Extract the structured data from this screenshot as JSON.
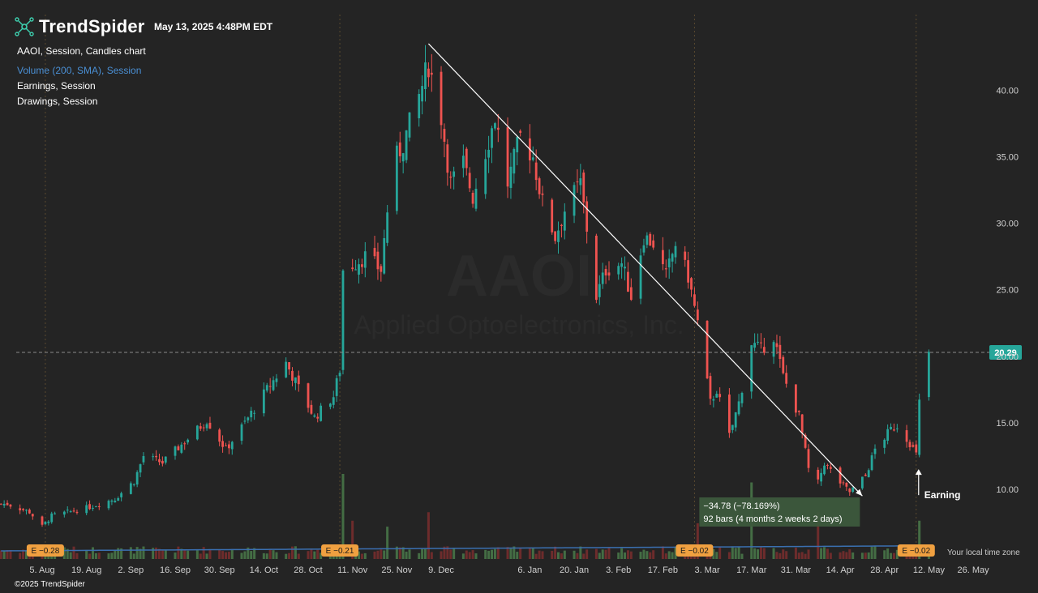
{
  "header": {
    "brand": "TrendSpider",
    "timestamp": "May 13, 2025 4:48PM EDT",
    "legend": [
      "AAOI, Session, Candles chart",
      "Volume (200, SMA), Session",
      "Earnings, Session",
      "Drawings, Session"
    ]
  },
  "watermark": {
    "symbol": "AAOI",
    "company": "Applied Optoelectronics, Inc."
  },
  "footer": {
    "copyright": "©2025 TrendSpider",
    "timezone_note": "Your local time zone"
  },
  "colors": {
    "up": "#26a69a",
    "down": "#ef5350",
    "background": "#242424",
    "price_tag": "#26a69a",
    "measure_box": "#3d5a3d",
    "earnings_badge": "#f0a040",
    "volume_sma": "#3a6fb0"
  },
  "chart_data": {
    "type": "candlestick",
    "symbol": "AAOI",
    "last_price": "20.29",
    "y_ticks": [
      "40.00",
      "35.00",
      "30.00",
      "25.00",
      "20.00",
      "15.00",
      "10.00"
    ],
    "ylim": [
      4.0,
      43.6
    ],
    "x_ticks": [
      "5. Aug",
      "19. Aug",
      "2. Sep",
      "16. Sep",
      "30. Sep",
      "14. Oct",
      "28. Oct",
      "11. Nov",
      "25. Nov",
      "9. Dec",
      "6. Jan",
      "20. Jan",
      "3. Feb",
      "17. Feb",
      "3. Mar",
      "17. Mar",
      "31. Mar",
      "14. Apr",
      "28. Apr",
      "12. May",
      "26. May"
    ],
    "price_anchors": [
      [
        "2024-07-25",
        8.9
      ],
      [
        "2024-08-01",
        8.3
      ],
      [
        "2024-08-05",
        7.2
      ],
      [
        "2024-08-08",
        8.0
      ],
      [
        "2024-08-19",
        8.6
      ],
      [
        "2024-08-28",
        9.3
      ],
      [
        "2024-09-03",
        10.6
      ],
      [
        "2024-09-06",
        12.5
      ],
      [
        "2024-09-12",
        12.0
      ],
      [
        "2024-09-20",
        13.8
      ],
      [
        "2024-09-26",
        15.2
      ],
      [
        "2024-10-02",
        13.0
      ],
      [
        "2024-10-08",
        15.0
      ],
      [
        "2024-10-15",
        17.5
      ],
      [
        "2024-10-21",
        19.5
      ],
      [
        "2024-10-25",
        17.6
      ],
      [
        "2024-10-30",
        15.4
      ],
      [
        "2024-11-05",
        17.0
      ],
      [
        "2024-11-07",
        19.0
      ],
      [
        "2024-11-08",
        26.5
      ],
      [
        "2024-11-15",
        27.5
      ],
      [
        "2024-11-20",
        26.5
      ],
      [
        "2024-11-22",
        31.0
      ],
      [
        "2024-11-25",
        35.0
      ],
      [
        "2024-11-27",
        36.0
      ],
      [
        "2024-12-02",
        39.5
      ],
      [
        "2024-12-05",
        42.0
      ],
      [
        "2024-12-09",
        38.0
      ],
      [
        "2024-12-12",
        33.0
      ],
      [
        "2024-12-16",
        34.5
      ],
      [
        "2024-12-19",
        32.0
      ],
      [
        "2024-12-26",
        38.0
      ],
      [
        "2024-12-30",
        33.0
      ],
      [
        "2025-01-03",
        36.5
      ],
      [
        "2025-01-07",
        35.0
      ],
      [
        "2025-01-10",
        31.5
      ],
      [
        "2025-01-14",
        29.0
      ],
      [
        "2025-01-17",
        31.0
      ],
      [
        "2025-01-22",
        33.0
      ],
      [
        "2025-01-27",
        24.5
      ],
      [
        "2025-01-30",
        26.5
      ],
      [
        "2025-02-04",
        27.0
      ],
      [
        "2025-02-07",
        24.5
      ],
      [
        "2025-02-11",
        29.0
      ],
      [
        "2025-02-14",
        28.5
      ],
      [
        "2025-02-18",
        26.0
      ],
      [
        "2025-02-21",
        28.5
      ],
      [
        "2025-02-25",
        26.0
      ],
      [
        "2025-02-28",
        22.5
      ],
      [
        "2025-03-04",
        16.5
      ],
      [
        "2025-03-06",
        17.5
      ],
      [
        "2025-03-10",
        14.0
      ],
      [
        "2025-03-13",
        16.5
      ],
      [
        "2025-03-17",
        21.0
      ],
      [
        "2025-03-20",
        20.5
      ],
      [
        "2025-03-24",
        21.5
      ],
      [
        "2025-03-27",
        18.5
      ],
      [
        "2025-04-01",
        15.5
      ],
      [
        "2025-04-04",
        11.5
      ],
      [
        "2025-04-07",
        10.5
      ],
      [
        "2025-04-09",
        12.0
      ],
      [
        "2025-04-14",
        10.5
      ],
      [
        "2025-04-17",
        9.8
      ],
      [
        "2025-04-22",
        11.0
      ],
      [
        "2025-04-25",
        13.0
      ],
      [
        "2025-04-30",
        14.5
      ],
      [
        "2025-05-02",
        14.8
      ],
      [
        "2025-05-06",
        13.5
      ],
      [
        "2025-05-08",
        12.6
      ],
      [
        "2025-05-09",
        16.5
      ],
      [
        "2025-05-12",
        20.29
      ]
    ],
    "trendline": {
      "from": [
        "2024-12-05",
        43.5
      ],
      "to": [
        "2025-04-21",
        9.5
      ]
    },
    "measurement": {
      "change": "−34.78 (−78.169%)",
      "bars": "92 bars (4 months 2 weeks 2 days)"
    },
    "earnings_markers": [
      {
        "date": "2024-08-06",
        "label": "E −0.28"
      },
      {
        "date": "2024-11-07",
        "label": "E −0.21"
      },
      {
        "date": "2025-02-27",
        "label": "E −0.02"
      },
      {
        "date": "2025-05-08",
        "label": "E −0.02"
      }
    ],
    "annotation": {
      "date": "2025-05-08",
      "price": 12.0,
      "text": "Earning"
    },
    "volume_spikes": [
      [
        "2024-11-08",
        1.0
      ],
      [
        "2024-11-11",
        0.45
      ],
      [
        "2024-11-22",
        0.38
      ],
      [
        "2024-12-05",
        0.55
      ],
      [
        "2025-02-28",
        0.42
      ],
      [
        "2025-03-17",
        0.9
      ],
      [
        "2025-04-07",
        0.55
      ],
      [
        "2025-05-09",
        0.45
      ]
    ]
  }
}
